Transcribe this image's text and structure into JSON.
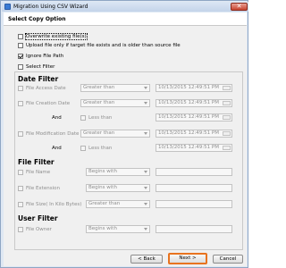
{
  "window": {
    "title": "Migration Using CSV Wizard",
    "close_glyph": "✕"
  },
  "header": {
    "title": "Select Copy Option"
  },
  "options": [
    {
      "label": "Overwrite existing file(s)",
      "checked": false,
      "focused": true
    },
    {
      "label": "Upload file only if target file exists and is older than source file",
      "checked": false
    },
    {
      "label": "Ignore File Path",
      "checked": true
    },
    {
      "label": "Select Filter",
      "checked": false
    }
  ],
  "date_filter": {
    "title": "Date Filter",
    "and_label": "And",
    "access": {
      "label": "File Access Date",
      "operator": "Greater than",
      "datetime": "10/13/2015 12:49:51 PM"
    },
    "creation": {
      "label": "File Creation Date",
      "operator": "Greater than",
      "datetime": "10/13/2015 12:49:51 PM",
      "less_label": "Less than",
      "less_datetime": "10/13/2015 12:49:51 PM"
    },
    "modification": {
      "label": "File Modification Date",
      "operator": "Greater than",
      "datetime": "10/13/2015 12:49:51 PM",
      "less_label": "Less than",
      "less_datetime": "10/13/2015 12:49:51 PM"
    }
  },
  "file_filter": {
    "title": "File Filter",
    "name": {
      "label": "File Name",
      "operator": "Begins with"
    },
    "extension": {
      "label": "File Extension",
      "operator": "Begins with"
    },
    "size": {
      "label": "File Size( In Kilo Bytes)",
      "operator": "Greater than"
    }
  },
  "user_filter": {
    "title": "User Filter",
    "owner": {
      "label": "File Owner",
      "operator": "Begins with"
    }
  },
  "footer": {
    "back_label": "< Back",
    "next_label": "Next >",
    "cancel_label": "Cancel"
  },
  "colors": {
    "accent": "#e8731f",
    "titlebar": "#c4d4ea",
    "close": "#c7432f"
  }
}
